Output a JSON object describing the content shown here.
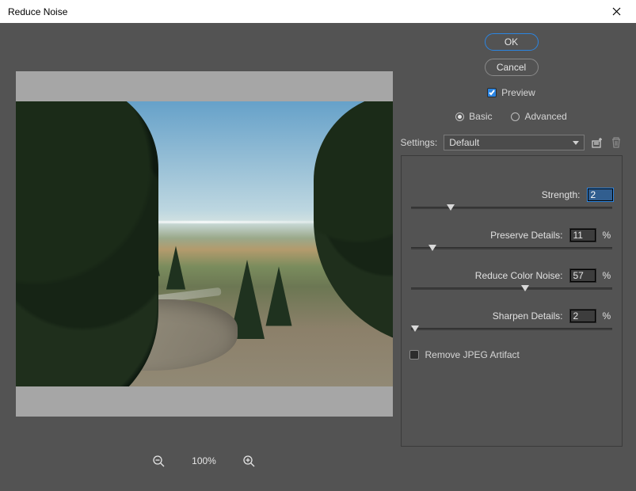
{
  "window": {
    "title": "Reduce Noise"
  },
  "buttons": {
    "ok": "OK",
    "cancel": "Cancel"
  },
  "preview_checkbox": {
    "label": "Preview",
    "checked": true
  },
  "modes": {
    "basic": {
      "label": "Basic",
      "selected": true
    },
    "advanced": {
      "label": "Advanced",
      "selected": false
    }
  },
  "settings": {
    "label": "Settings:",
    "selected": "Default"
  },
  "params": {
    "strength": {
      "label": "Strength:",
      "value": "2",
      "suffix": "",
      "active": true,
      "pos_pct": 20
    },
    "preserve_details": {
      "label": "Preserve Details:",
      "value": "11",
      "suffix": "%",
      "active": false,
      "pos_pct": 11
    },
    "reduce_color": {
      "label": "Reduce Color Noise:",
      "value": "57",
      "suffix": "%",
      "active": false,
      "pos_pct": 57
    },
    "sharpen_details": {
      "label": "Sharpen Details:",
      "value": "2",
      "suffix": "%",
      "active": false,
      "pos_pct": 2
    }
  },
  "jpeg_artifact": {
    "label": "Remove JPEG Artifact",
    "checked": false
  },
  "zoom": {
    "level": "100%"
  }
}
